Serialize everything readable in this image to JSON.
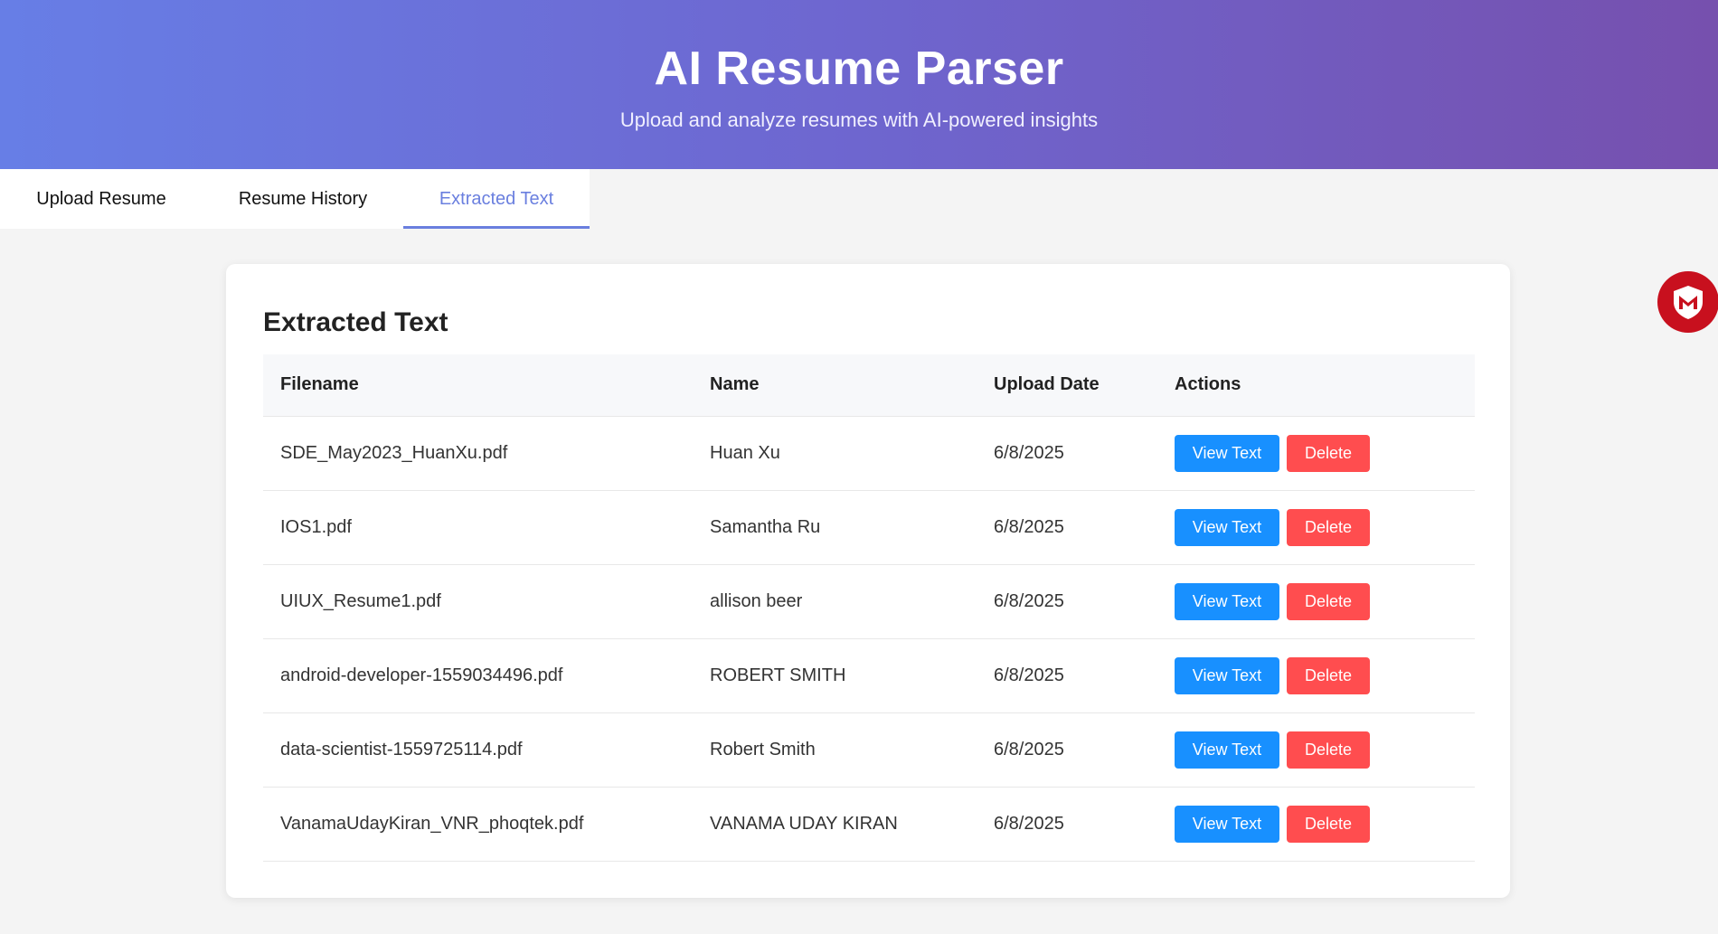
{
  "header": {
    "title": "AI Resume Parser",
    "subtitle": "Upload and analyze resumes with AI-powered insights"
  },
  "tabs": [
    {
      "label": "Upload Resume",
      "active": false
    },
    {
      "label": "Resume History",
      "active": false
    },
    {
      "label": "Extracted Text",
      "active": true
    }
  ],
  "card": {
    "title": "Extracted Text",
    "columns": [
      "Filename",
      "Name",
      "Upload Date",
      "Actions"
    ],
    "rows": [
      {
        "filename": "SDE_May2023_HuanXu.pdf",
        "name": "Huan Xu",
        "date": "6/8/2025",
        "view": "View Text",
        "delete": "Delete"
      },
      {
        "filename": "IOS1.pdf",
        "name": "Samantha Ru",
        "date": "6/8/2025",
        "view": "View Text",
        "delete": "Delete"
      },
      {
        "filename": "UIUX_Resume1.pdf",
        "name": "allison beer",
        "date": "6/8/2025",
        "view": "View Text",
        "delete": "Delete"
      },
      {
        "filename": "android-developer-1559034496.pdf",
        "name": "ROBERT SMITH",
        "date": "6/8/2025",
        "view": "View Text",
        "delete": "Delete"
      },
      {
        "filename": "data-scientist-1559725114.pdf",
        "name": "Robert Smith",
        "date": "6/8/2025",
        "view": "View Text",
        "delete": "Delete"
      },
      {
        "filename": "VanamaUdayKiran_VNR_phoqtek.pdf",
        "name": "VANAMA UDAY KIRAN",
        "date": "6/8/2025",
        "view": "View Text",
        "delete": "Delete"
      }
    ]
  },
  "extension_icon": "shield-m-icon",
  "colors": {
    "accent": "#6a7fdf",
    "view_button": "#1890ff",
    "delete_button": "#ff4d4f",
    "extension": "#c8101e"
  }
}
